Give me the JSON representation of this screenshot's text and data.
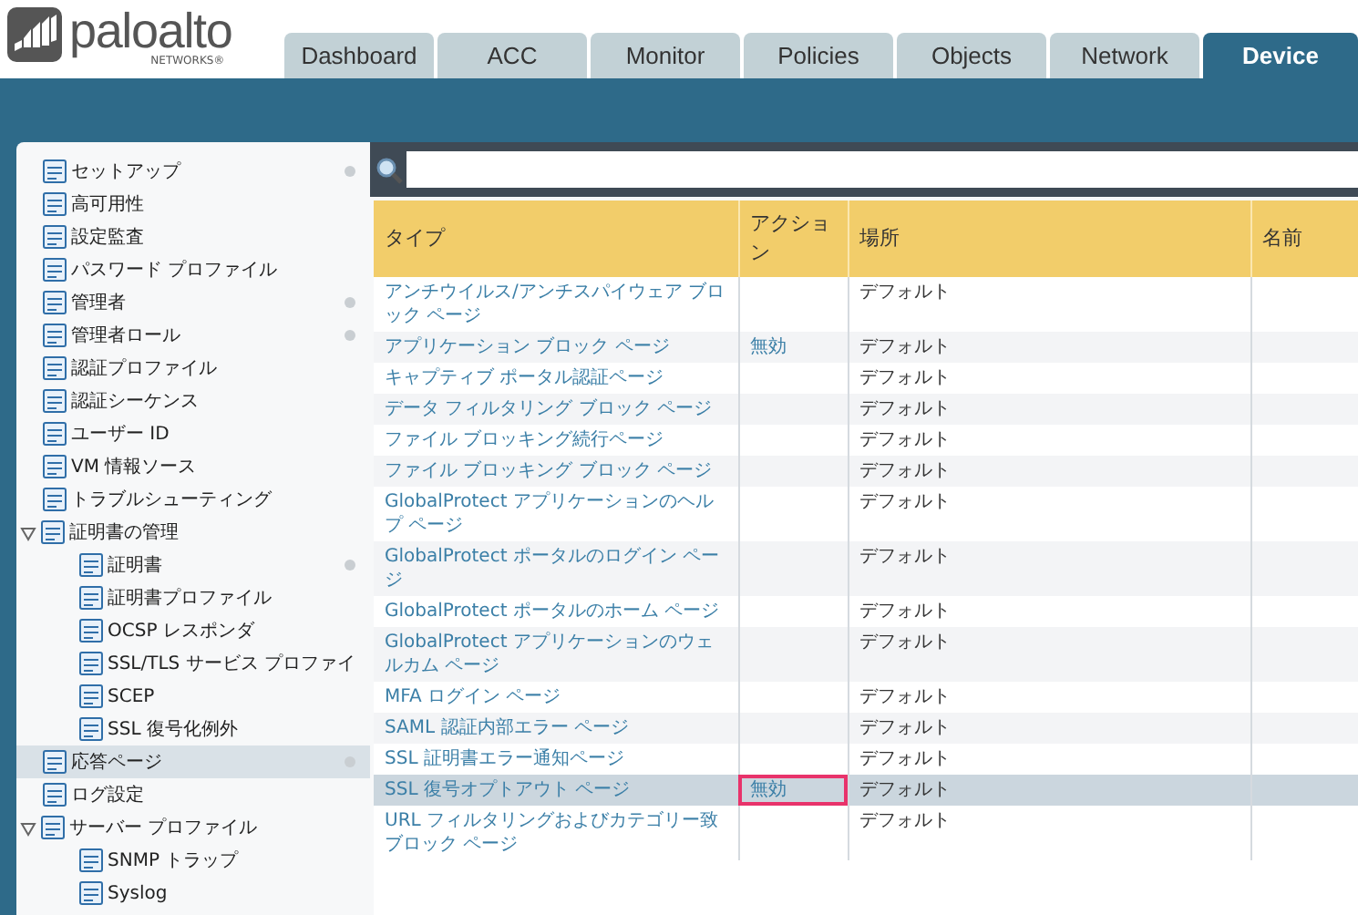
{
  "logo": {
    "wordmark": "paloalto",
    "subtitle": "NETWORKS®"
  },
  "tabs": [
    {
      "label": "Dashboard",
      "selected": false
    },
    {
      "label": "ACC",
      "selected": false
    },
    {
      "label": "Monitor",
      "selected": false
    },
    {
      "label": "Policies",
      "selected": false
    },
    {
      "label": "Objects",
      "selected": false
    },
    {
      "label": "Network",
      "selected": false
    },
    {
      "label": "Device",
      "selected": true
    }
  ],
  "sidebar": {
    "items": [
      {
        "label": "セットアップ",
        "dot": true,
        "selected": false
      },
      {
        "label": "高可用性",
        "dot": false,
        "selected": false
      },
      {
        "label": "設定監査",
        "dot": false,
        "selected": false
      },
      {
        "label": "パスワード プロファイル",
        "dot": false,
        "selected": false
      },
      {
        "label": "管理者",
        "dot": true,
        "selected": false
      },
      {
        "label": "管理者ロール",
        "dot": true,
        "selected": false
      },
      {
        "label": "認証プロファイル",
        "dot": false,
        "selected": false
      },
      {
        "label": "認証シーケンス",
        "dot": false,
        "selected": false
      },
      {
        "label": "ユーザー ID",
        "dot": false,
        "selected": false
      },
      {
        "label": "VM 情報ソース",
        "dot": false,
        "selected": false
      },
      {
        "label": "トラブルシューティング",
        "dot": false,
        "selected": false
      },
      {
        "label": "証明書の管理",
        "dot": false,
        "selected": false,
        "expanded": true,
        "children": [
          {
            "label": "証明書",
            "dot": true,
            "selected": false
          },
          {
            "label": "証明書プロファイル",
            "dot": false,
            "selected": false
          },
          {
            "label": "OCSP レスポンダ",
            "dot": false,
            "selected": false
          },
          {
            "label": "SSL/TLS サービス プロファイ",
            "dot": false,
            "selected": false
          },
          {
            "label": "SCEP",
            "dot": false,
            "selected": false
          },
          {
            "label": "SSL 復号化例外",
            "dot": false,
            "selected": false
          }
        ]
      },
      {
        "label": "応答ページ",
        "dot": true,
        "selected": true
      },
      {
        "label": "ログ設定",
        "dot": false,
        "selected": false
      },
      {
        "label": "サーバー プロファイル",
        "dot": false,
        "selected": false,
        "expanded": true,
        "children": [
          {
            "label": "SNMP トラップ",
            "dot": false,
            "selected": false
          },
          {
            "label": "Syslog",
            "dot": false,
            "selected": false
          }
        ]
      }
    ]
  },
  "table": {
    "columns": [
      "タイプ",
      "アクション",
      "場所",
      "名前"
    ],
    "rows": [
      {
        "type": "アンチウイルス/アンチスパイウェア ブロック ページ",
        "action": "",
        "location": "デフォルト",
        "selected": false,
        "highlighted": false
      },
      {
        "type": "アプリケーション ブロック ページ",
        "action": "無効",
        "location": "デフォルト",
        "selected": false,
        "highlighted": false
      },
      {
        "type": "キャプティブ ポータル認証ページ",
        "action": "",
        "location": "デフォルト",
        "selected": false,
        "highlighted": false
      },
      {
        "type": "データ フィルタリング ブロック ページ",
        "action": "",
        "location": "デフォルト",
        "selected": false,
        "highlighted": false
      },
      {
        "type": "ファイル ブロッキング続行ページ",
        "action": "",
        "location": "デフォルト",
        "selected": false,
        "highlighted": false
      },
      {
        "type": "ファイル ブロッキング ブロック ページ",
        "action": "",
        "location": "デフォルト",
        "selected": false,
        "highlighted": false
      },
      {
        "type": "GlobalProtect アプリケーションのヘルプ ページ",
        "action": "",
        "location": "デフォルト",
        "selected": false,
        "highlighted": false
      },
      {
        "type": "GlobalProtect ポータルのログイン ページ",
        "action": "",
        "location": "デフォルト",
        "selected": false,
        "highlighted": false
      },
      {
        "type": "GlobalProtect ポータルのホーム ページ",
        "action": "",
        "location": "デフォルト",
        "selected": false,
        "highlighted": false
      },
      {
        "type": "GlobalProtect アプリケーションのウェルカム ページ",
        "action": "",
        "location": "デフォルト",
        "selected": false,
        "highlighted": false
      },
      {
        "type": "MFA ログイン ページ",
        "action": "",
        "location": "デフォルト",
        "selected": false,
        "highlighted": false
      },
      {
        "type": "SAML 認証内部エラー ページ",
        "action": "",
        "location": "デフォルト",
        "selected": false,
        "highlighted": false
      },
      {
        "type": "SSL 証明書エラー通知ページ",
        "action": "",
        "location": "デフォルト",
        "selected": false,
        "highlighted": false
      },
      {
        "type": "SSL 復号オプトアウト ページ",
        "action": "無効",
        "location": "デフォルト",
        "selected": true,
        "highlighted": true
      },
      {
        "type": "URL フィルタリングおよびカテゴリー致ブロック ページ",
        "action": "",
        "location": "デフォルト",
        "selected": false,
        "highlighted": false
      }
    ]
  }
}
